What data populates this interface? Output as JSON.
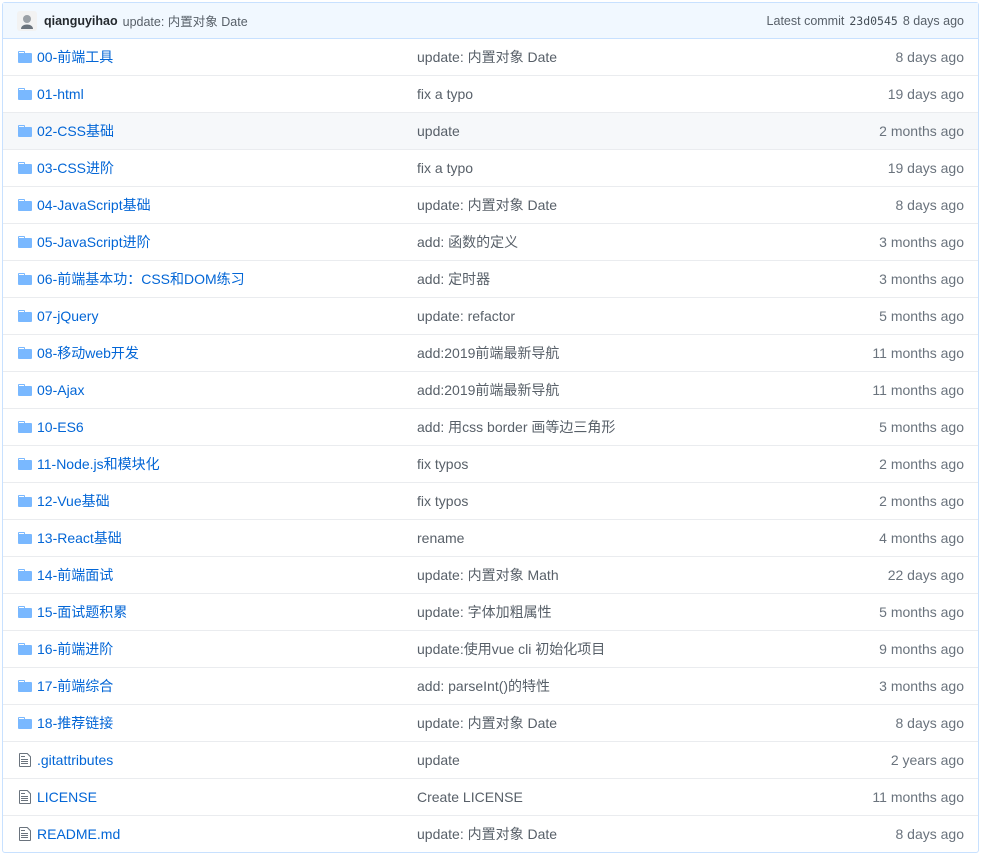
{
  "header": {
    "author": "qianguyihao",
    "message": "update: 内置对象 Date",
    "latest_label": "Latest commit",
    "sha": "23d0545",
    "age": "8 days ago"
  },
  "colors": {
    "link": "#0366d6",
    "folder_icon": "#79b8ff",
    "header_bg": "#f1f8ff"
  },
  "rows": [
    {
      "type": "folder",
      "name": "00-前端工具",
      "message": "update: 内置对象 Date",
      "age": "8 days ago"
    },
    {
      "type": "folder",
      "name": "01-html",
      "message": "fix a typo",
      "age": "19 days ago"
    },
    {
      "type": "folder",
      "name": "02-CSS基础",
      "message": "update",
      "age": "2 months ago"
    },
    {
      "type": "folder",
      "name": "03-CSS进阶",
      "message": "fix a typo",
      "age": "19 days ago"
    },
    {
      "type": "folder",
      "name": "04-JavaScript基础",
      "message": "update: 内置对象 Date",
      "age": "8 days ago"
    },
    {
      "type": "folder",
      "name": "05-JavaScript进阶",
      "message": "add: 函数的定义",
      "age": "3 months ago"
    },
    {
      "type": "folder",
      "name": "06-前端基本功：CSS和DOM练习",
      "message": "add: 定时器",
      "age": "3 months ago"
    },
    {
      "type": "folder",
      "name": "07-jQuery",
      "message": "update: refactor",
      "age": "5 months ago"
    },
    {
      "type": "folder",
      "name": "08-移动web开发",
      "message": "add:2019前端最新导航",
      "age": "11 months ago"
    },
    {
      "type": "folder",
      "name": "09-Ajax",
      "message": "add:2019前端最新导航",
      "age": "11 months ago"
    },
    {
      "type": "folder",
      "name": "10-ES6",
      "message": " add: 用css border 画等边三角形",
      "age": "5 months ago"
    },
    {
      "type": "folder",
      "name": "11-Node.js和模块化",
      "message": "fix typos",
      "age": "2 months ago"
    },
    {
      "type": "folder",
      "name": "12-Vue基础",
      "message": "fix typos",
      "age": "2 months ago"
    },
    {
      "type": "folder",
      "name": "13-React基础",
      "message": "rename",
      "age": "4 months ago"
    },
    {
      "type": "folder",
      "name": "14-前端面试",
      "message": "update: 内置对象 Math",
      "age": "22 days ago"
    },
    {
      "type": "folder",
      "name": "15-面试题积累",
      "message": "update: 字体加粗属性",
      "age": "5 months ago"
    },
    {
      "type": "folder",
      "name": "16-前端进阶",
      "message": "update:使用vue cli 初始化项目",
      "age": "9 months ago"
    },
    {
      "type": "folder",
      "name": "17-前端综合",
      "message": "add: parseInt()的特性",
      "age": "3 months ago"
    },
    {
      "type": "folder",
      "name": "18-推荐链接",
      "message": "update: 内置对象 Date",
      "age": "8 days ago"
    },
    {
      "type": "file",
      "name": ".gitattributes",
      "message": "update",
      "age": "2 years ago"
    },
    {
      "type": "file",
      "name": "LICENSE",
      "message": "Create LICENSE",
      "age": "11 months ago"
    },
    {
      "type": "file",
      "name": "README.md",
      "message": "update: 内置对象 Date",
      "age": "8 days ago"
    }
  ]
}
